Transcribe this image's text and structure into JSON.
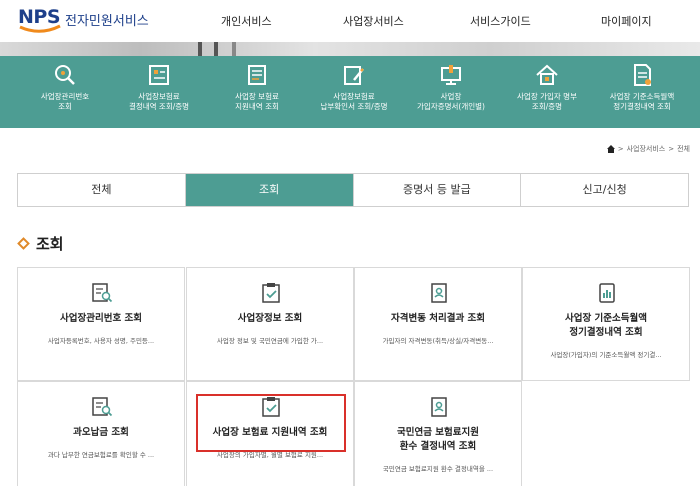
{
  "header": {
    "logo_brand": "NPS",
    "logo_text": "전자민원서비스",
    "nav": [
      "개인서비스",
      "사업장서비스",
      "서비스가이드",
      "마이페이지"
    ]
  },
  "quick_menu": [
    {
      "label": "사업장관리번호\n조회",
      "icon": "search-icon"
    },
    {
      "label": "사업장보험료\n결정내역 조회/증명",
      "icon": "calculator-icon"
    },
    {
      "label": "사업장 보험료\n지원내역 조회",
      "icon": "list-document-icon"
    },
    {
      "label": "사업장보험료\n납부확인서 조회/증명",
      "icon": "edit-document-icon"
    },
    {
      "label": "사업장\n가입자증명서(개인별)",
      "icon": "monitor-icon"
    },
    {
      "label": "사업장 가입자 명부\n조회/증명",
      "icon": "home-icon"
    },
    {
      "label": "사업장 기준소득월액\n정기결정내역 조회",
      "icon": "document-icon"
    }
  ],
  "breadcrumb": [
    "사업장서비스",
    "전체"
  ],
  "tabs": [
    "전체",
    "조회",
    "증명서 등 발급",
    "신고/신청"
  ],
  "active_tab": "조회",
  "section_title": "조회",
  "cards": [
    {
      "title": "사업장관리번호 조회",
      "desc": "사업자등록번호, 사용자 성명, 주민등...",
      "icon": "search-document-icon"
    },
    {
      "title": "사업장정보 조회",
      "desc": "사업장 정보 및 국민연금에 가입한 가...",
      "icon": "clipboard-check-icon"
    },
    {
      "title": "자격변동 처리결과 조회",
      "desc": "가입자의 자격변동(취득/상실/자격변동...",
      "icon": "id-card-icon"
    },
    {
      "title": "사업장 기준소득월액\n정기결정내역 조회",
      "desc": "사업장(가입자)의 기준소득월액 정기결...",
      "icon": "tablet-chart-icon"
    },
    {
      "title": "과오납금 조회",
      "desc": "과다 납부한 연금보험료를 확인할 수 ...",
      "icon": "search-document-icon"
    },
    {
      "title": "사업장 보험료 지원내역 조회",
      "desc": "사업장의 가입자별, 월별 보험료 지원...",
      "icon": "clipboard-check-icon"
    },
    {
      "title": "국민연금 보험료지원\n환수 결정내역 조회",
      "desc": "국민연금 보험료지원 환수 결정내역을 ...",
      "icon": "id-card-icon"
    }
  ],
  "colors": {
    "accent": "#4d9d93",
    "highlight": "#d9302a",
    "brand": "#1d3f8a",
    "bullet": "#e08a2a"
  }
}
